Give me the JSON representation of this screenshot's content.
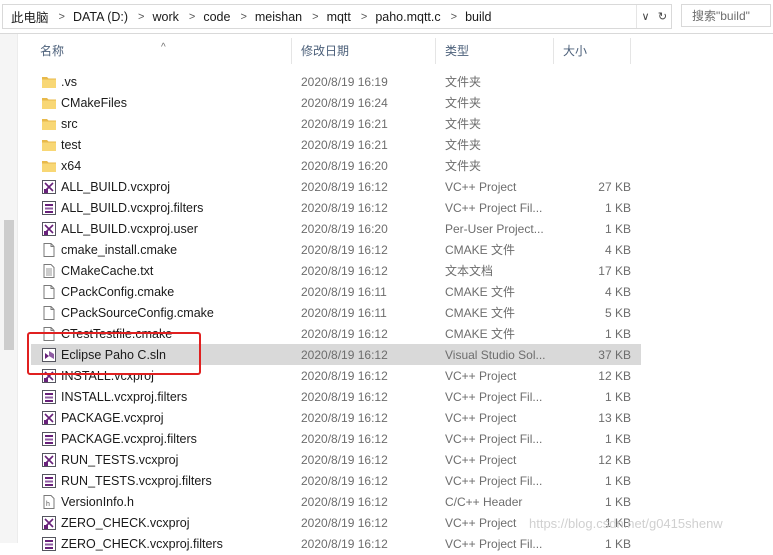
{
  "address": {
    "crumbs": [
      "此电脑",
      "DATA (D:)",
      "work",
      "code",
      "meishan",
      "mqtt",
      "paho.mqtt.c",
      "build"
    ],
    "dropdown_glyph": "∨",
    "refresh_glyph": "↻"
  },
  "search": {
    "placeholder": "搜索\"build\""
  },
  "columns": {
    "name": "名称",
    "date": "修改日期",
    "type": "类型",
    "size": "大小"
  },
  "sort_glyph": "^",
  "files": [
    {
      "name": ".vs",
      "date": "2020/8/19 16:19",
      "type": "文件夹",
      "size": "",
      "icon": "folder-icon"
    },
    {
      "name": "CMakeFiles",
      "date": "2020/8/19 16:24",
      "type": "文件夹",
      "size": "",
      "icon": "folder-icon"
    },
    {
      "name": "src",
      "date": "2020/8/19 16:21",
      "type": "文件夹",
      "size": "",
      "icon": "folder-icon"
    },
    {
      "name": "test",
      "date": "2020/8/19 16:21",
      "type": "文件夹",
      "size": "",
      "icon": "folder-icon"
    },
    {
      "name": "x64",
      "date": "2020/8/19 16:20",
      "type": "文件夹",
      "size": "",
      "icon": "folder-icon"
    },
    {
      "name": "ALL_BUILD.vcxproj",
      "date": "2020/8/19 16:12",
      "type": "VC++ Project",
      "size": "27 KB",
      "icon": "vcxproj-icon"
    },
    {
      "name": "ALL_BUILD.vcxproj.filters",
      "date": "2020/8/19 16:12",
      "type": "VC++ Project Fil...",
      "size": "1 KB",
      "icon": "filters-icon"
    },
    {
      "name": "ALL_BUILD.vcxproj.user",
      "date": "2020/8/19 16:20",
      "type": "Per-User Project...",
      "size": "1 KB",
      "icon": "vcxproj-icon"
    },
    {
      "name": "cmake_install.cmake",
      "date": "2020/8/19 16:12",
      "type": "CMAKE 文件",
      "size": "4 KB",
      "icon": "file-icon"
    },
    {
      "name": "CMakeCache.txt",
      "date": "2020/8/19 16:12",
      "type": "文本文档",
      "size": "17 KB",
      "icon": "text-file-icon"
    },
    {
      "name": "CPackConfig.cmake",
      "date": "2020/8/19 16:11",
      "type": "CMAKE 文件",
      "size": "4 KB",
      "icon": "file-icon"
    },
    {
      "name": "CPackSourceConfig.cmake",
      "date": "2020/8/19 16:11",
      "type": "CMAKE 文件",
      "size": "5 KB",
      "icon": "file-icon"
    },
    {
      "name": "CTestTestfile.cmake",
      "date": "2020/8/19 16:12",
      "type": "CMAKE 文件",
      "size": "1 KB",
      "icon": "file-icon"
    },
    {
      "name": "Eclipse Paho C.sln",
      "date": "2020/8/19 16:12",
      "type": "Visual Studio Sol...",
      "size": "37 KB",
      "icon": "vs-solution-icon",
      "selected": true
    },
    {
      "name": "INSTALL.vcxproj",
      "date": "2020/8/19 16:12",
      "type": "VC++ Project",
      "size": "12 KB",
      "icon": "vcxproj-icon"
    },
    {
      "name": "INSTALL.vcxproj.filters",
      "date": "2020/8/19 16:12",
      "type": "VC++ Project Fil...",
      "size": "1 KB",
      "icon": "filters-icon"
    },
    {
      "name": "PACKAGE.vcxproj",
      "date": "2020/8/19 16:12",
      "type": "VC++ Project",
      "size": "13 KB",
      "icon": "vcxproj-icon"
    },
    {
      "name": "PACKAGE.vcxproj.filters",
      "date": "2020/8/19 16:12",
      "type": "VC++ Project Fil...",
      "size": "1 KB",
      "icon": "filters-icon"
    },
    {
      "name": "RUN_TESTS.vcxproj",
      "date": "2020/8/19 16:12",
      "type": "VC++ Project",
      "size": "12 KB",
      "icon": "vcxproj-icon"
    },
    {
      "name": "RUN_TESTS.vcxproj.filters",
      "date": "2020/8/19 16:12",
      "type": "VC++ Project Fil...",
      "size": "1 KB",
      "icon": "filters-icon"
    },
    {
      "name": "VersionInfo.h",
      "date": "2020/8/19 16:12",
      "type": "C/C++ Header",
      "size": "1 KB",
      "icon": "header-file-icon"
    },
    {
      "name": "ZERO_CHECK.vcxproj",
      "date": "2020/8/19 16:12",
      "type": "VC++ Project",
      "size": "1 KB",
      "icon": "vcxproj-icon"
    },
    {
      "name": "ZERO_CHECK.vcxproj.filters",
      "date": "2020/8/19 16:12",
      "type": "VC++ Project Fil...",
      "size": "1 KB",
      "icon": "filters-icon"
    }
  ],
  "watermark": "https://blog.csdn.net/g0415shenw",
  "colors": {
    "folder": "#f8d775",
    "selected_row": "#d9d9d9",
    "highlight_box": "#e02020"
  }
}
